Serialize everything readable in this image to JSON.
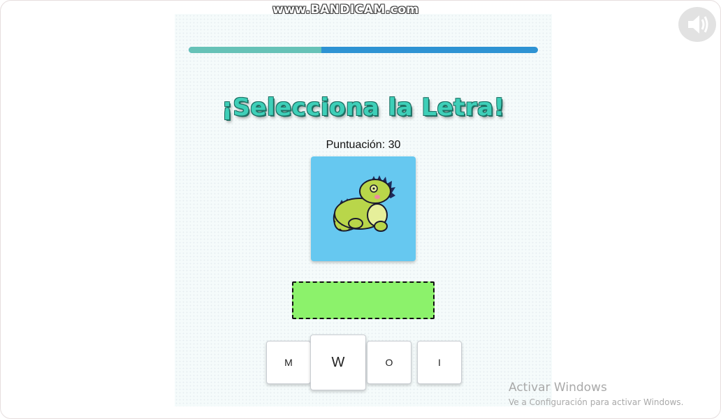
{
  "watermark": "www.BANDICAM.com",
  "progress": {
    "fraction": 0.38
  },
  "title": "¡Selecciona la Letra!",
  "score_text": "Puntuación: 30",
  "answer_slot": {
    "value": ""
  },
  "letters": [
    {
      "label": "M"
    },
    {
      "label": "W"
    },
    {
      "label": "O"
    },
    {
      "label": "I"
    }
  ],
  "windows_notice": {
    "title": "Activar Windows",
    "subtitle": "Ve a Configuración para activar Windows."
  },
  "colors": {
    "accent_title": "#3ecfb8",
    "progress_done": "#66c2b7",
    "progress_remaining": "#2e93d3",
    "drop_zone": "#8cf26b",
    "card_bg": "#66c8f0"
  },
  "icons": [
    "speaker-icon",
    "iguana-illustration"
  ]
}
